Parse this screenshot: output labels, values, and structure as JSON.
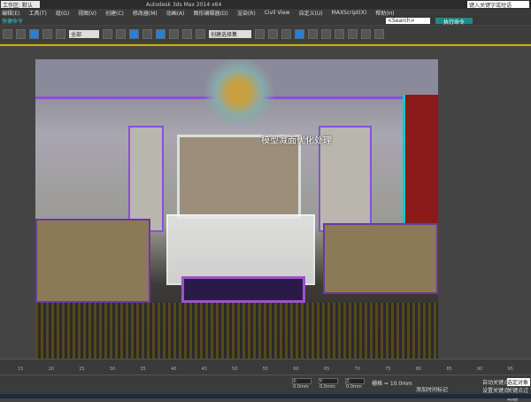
{
  "title_bar": {
    "workspace": "工作区: 默认",
    "title": "Autodesk 3ds Max 2014 x64",
    "search_placeholder": "键入关键字或短语"
  },
  "menu": [
    "编辑(E)",
    "工具(T)",
    "组(G)",
    "视图(V)",
    "创建(C)",
    "修改器(M)",
    "动画(A)",
    "图形编辑器(D)",
    "渲染(R)",
    "Civil View",
    "自定义(U)",
    "MAXScript(X)",
    "帮助(H)"
  ],
  "command_bar": {
    "label": "快捷命令",
    "search_value": "<Search>",
    "button_label": "执行命令"
  },
  "toolbar": {
    "filter_select": "全部",
    "selection_set": "创建选择集"
  },
  "viewport": {
    "overlay_text": "模型减面优化处理"
  },
  "timeline": {
    "ticks": [
      "15",
      "20",
      "25",
      "30",
      "35",
      "40",
      "45",
      "50",
      "55",
      "60",
      "65",
      "70",
      "75",
      "80",
      "85",
      "90",
      "95"
    ]
  },
  "status": {
    "x": "X: 0.0mm",
    "y": "Y: 0.0mm",
    "z": "Z: 0.0mm",
    "grid": "栅格 = 10.0mm",
    "auto_key": "自动关键点",
    "set_key": "设置关键点",
    "selected": "选定对象",
    "add_time_tag": "添加时间标记",
    "key_filters": "关键点过滤器"
  },
  "colors": {
    "accent": "#2a7fd4",
    "viewport_border": "#c8b400",
    "command_button": "#1a8a84"
  }
}
